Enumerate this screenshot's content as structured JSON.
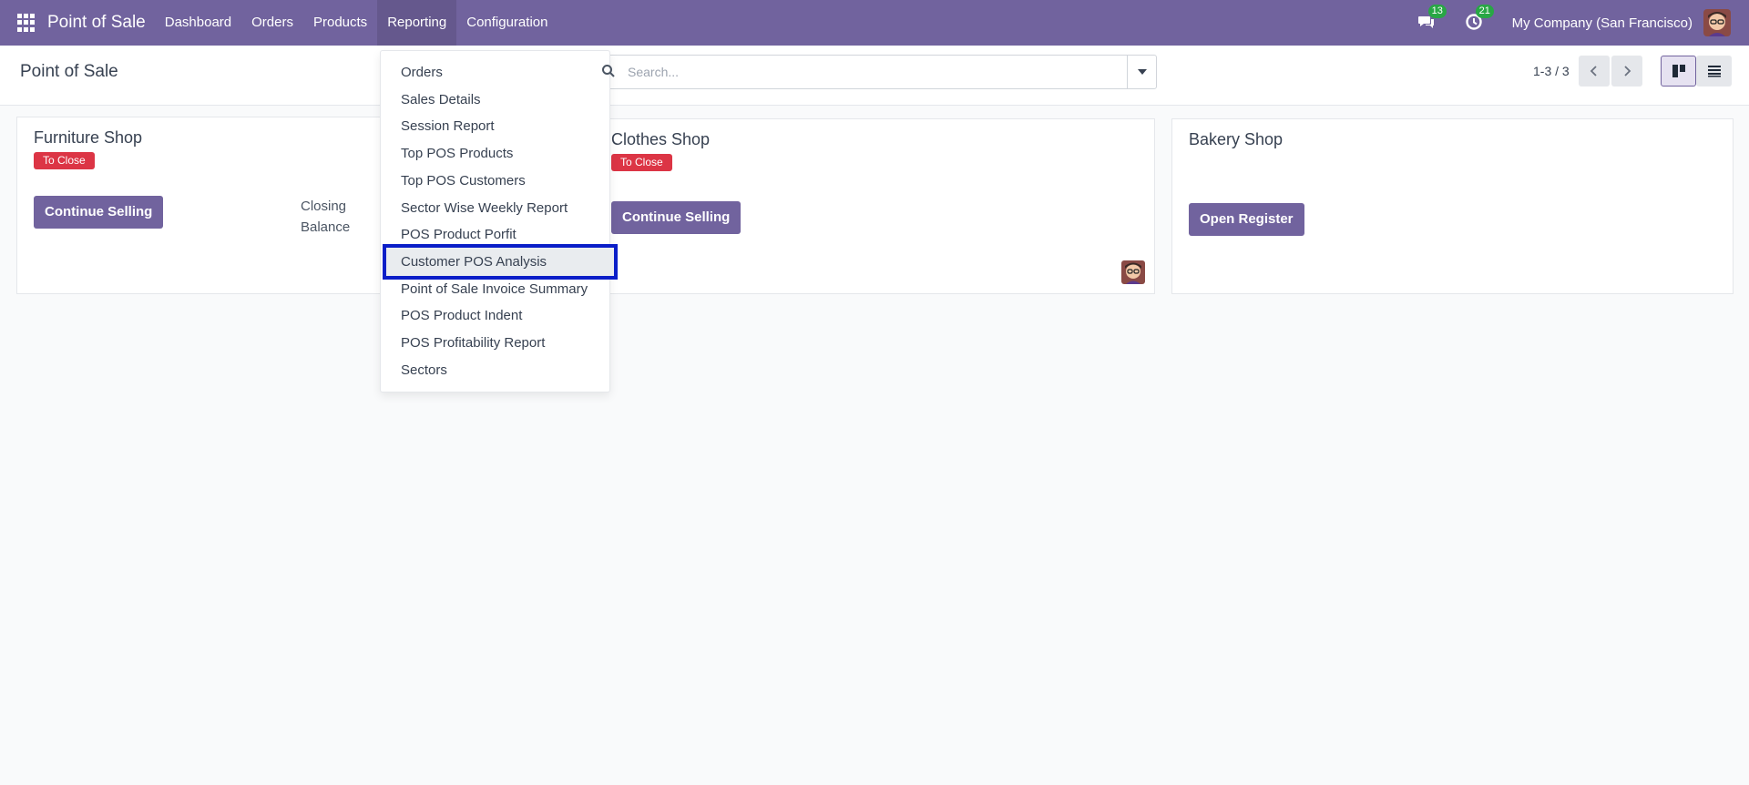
{
  "navbar": {
    "brand": "Point of Sale",
    "menu": [
      "Dashboard",
      "Orders",
      "Products",
      "Reporting",
      "Configuration"
    ],
    "messages_count": "13",
    "activities_count": "21",
    "company": "My Company (San Francisco)"
  },
  "control_panel": {
    "title": "Point of Sale",
    "search_placeholder": "Search...",
    "pager": "1-3 / 3"
  },
  "cards": {
    "furniture": {
      "name": "Furniture Shop",
      "status": "To Close",
      "button": "Continue Selling",
      "closing_label_1": "Closing",
      "closing_label_2": "Balance"
    },
    "clothes": {
      "name": "Clothes Shop",
      "status": "To Close",
      "button": "Continue Selling"
    },
    "bakery": {
      "name": "Bakery Shop",
      "button": "Open Register"
    }
  },
  "reporting_menu": {
    "items": [
      "Orders",
      "Sales Details",
      "Session Report",
      "Top POS Products",
      "Top POS Customers",
      "Sector Wise Weekly Report",
      "POS Product Porfit",
      "Customer POS Analysis",
      "Point of Sale Invoice Summary",
      "POS Product Indent",
      "POS Profitability Report",
      "Sectors"
    ],
    "highlighted": "Customer POS Analysis"
  },
  "colors": {
    "brand": "#71639e",
    "danger": "#dc3545",
    "badge": "#28a745",
    "highlight_border": "#0a1ec8"
  }
}
